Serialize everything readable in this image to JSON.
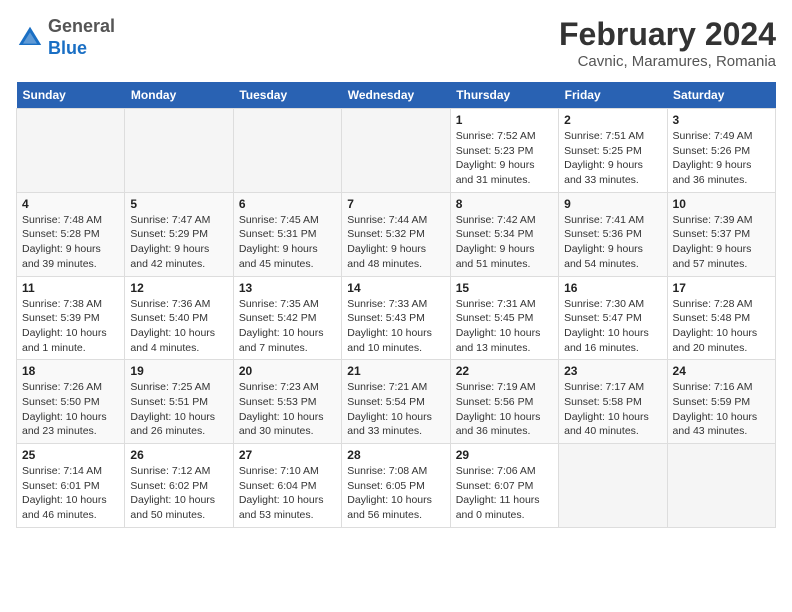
{
  "header": {
    "logo_line1": "General",
    "logo_line2": "Blue",
    "month": "February 2024",
    "location": "Cavnic, Maramures, Romania"
  },
  "days_of_week": [
    "Sunday",
    "Monday",
    "Tuesday",
    "Wednesday",
    "Thursday",
    "Friday",
    "Saturday"
  ],
  "weeks": [
    [
      {
        "num": "",
        "info": ""
      },
      {
        "num": "",
        "info": ""
      },
      {
        "num": "",
        "info": ""
      },
      {
        "num": "",
        "info": ""
      },
      {
        "num": "1",
        "info": "Sunrise: 7:52 AM\nSunset: 5:23 PM\nDaylight: 9 hours\nand 31 minutes."
      },
      {
        "num": "2",
        "info": "Sunrise: 7:51 AM\nSunset: 5:25 PM\nDaylight: 9 hours\nand 33 minutes."
      },
      {
        "num": "3",
        "info": "Sunrise: 7:49 AM\nSunset: 5:26 PM\nDaylight: 9 hours\nand 36 minutes."
      }
    ],
    [
      {
        "num": "4",
        "info": "Sunrise: 7:48 AM\nSunset: 5:28 PM\nDaylight: 9 hours\nand 39 minutes."
      },
      {
        "num": "5",
        "info": "Sunrise: 7:47 AM\nSunset: 5:29 PM\nDaylight: 9 hours\nand 42 minutes."
      },
      {
        "num": "6",
        "info": "Sunrise: 7:45 AM\nSunset: 5:31 PM\nDaylight: 9 hours\nand 45 minutes."
      },
      {
        "num": "7",
        "info": "Sunrise: 7:44 AM\nSunset: 5:32 PM\nDaylight: 9 hours\nand 48 minutes."
      },
      {
        "num": "8",
        "info": "Sunrise: 7:42 AM\nSunset: 5:34 PM\nDaylight: 9 hours\nand 51 minutes."
      },
      {
        "num": "9",
        "info": "Sunrise: 7:41 AM\nSunset: 5:36 PM\nDaylight: 9 hours\nand 54 minutes."
      },
      {
        "num": "10",
        "info": "Sunrise: 7:39 AM\nSunset: 5:37 PM\nDaylight: 9 hours\nand 57 minutes."
      }
    ],
    [
      {
        "num": "11",
        "info": "Sunrise: 7:38 AM\nSunset: 5:39 PM\nDaylight: 10 hours\nand 1 minute."
      },
      {
        "num": "12",
        "info": "Sunrise: 7:36 AM\nSunset: 5:40 PM\nDaylight: 10 hours\nand 4 minutes."
      },
      {
        "num": "13",
        "info": "Sunrise: 7:35 AM\nSunset: 5:42 PM\nDaylight: 10 hours\nand 7 minutes."
      },
      {
        "num": "14",
        "info": "Sunrise: 7:33 AM\nSunset: 5:43 PM\nDaylight: 10 hours\nand 10 minutes."
      },
      {
        "num": "15",
        "info": "Sunrise: 7:31 AM\nSunset: 5:45 PM\nDaylight: 10 hours\nand 13 minutes."
      },
      {
        "num": "16",
        "info": "Sunrise: 7:30 AM\nSunset: 5:47 PM\nDaylight: 10 hours\nand 16 minutes."
      },
      {
        "num": "17",
        "info": "Sunrise: 7:28 AM\nSunset: 5:48 PM\nDaylight: 10 hours\nand 20 minutes."
      }
    ],
    [
      {
        "num": "18",
        "info": "Sunrise: 7:26 AM\nSunset: 5:50 PM\nDaylight: 10 hours\nand 23 minutes."
      },
      {
        "num": "19",
        "info": "Sunrise: 7:25 AM\nSunset: 5:51 PM\nDaylight: 10 hours\nand 26 minutes."
      },
      {
        "num": "20",
        "info": "Sunrise: 7:23 AM\nSunset: 5:53 PM\nDaylight: 10 hours\nand 30 minutes."
      },
      {
        "num": "21",
        "info": "Sunrise: 7:21 AM\nSunset: 5:54 PM\nDaylight: 10 hours\nand 33 minutes."
      },
      {
        "num": "22",
        "info": "Sunrise: 7:19 AM\nSunset: 5:56 PM\nDaylight: 10 hours\nand 36 minutes."
      },
      {
        "num": "23",
        "info": "Sunrise: 7:17 AM\nSunset: 5:58 PM\nDaylight: 10 hours\nand 40 minutes."
      },
      {
        "num": "24",
        "info": "Sunrise: 7:16 AM\nSunset: 5:59 PM\nDaylight: 10 hours\nand 43 minutes."
      }
    ],
    [
      {
        "num": "25",
        "info": "Sunrise: 7:14 AM\nSunset: 6:01 PM\nDaylight: 10 hours\nand 46 minutes."
      },
      {
        "num": "26",
        "info": "Sunrise: 7:12 AM\nSunset: 6:02 PM\nDaylight: 10 hours\nand 50 minutes."
      },
      {
        "num": "27",
        "info": "Sunrise: 7:10 AM\nSunset: 6:04 PM\nDaylight: 10 hours\nand 53 minutes."
      },
      {
        "num": "28",
        "info": "Sunrise: 7:08 AM\nSunset: 6:05 PM\nDaylight: 10 hours\nand 56 minutes."
      },
      {
        "num": "29",
        "info": "Sunrise: 7:06 AM\nSunset: 6:07 PM\nDaylight: 11 hours\nand 0 minutes."
      },
      {
        "num": "",
        "info": ""
      },
      {
        "num": "",
        "info": ""
      }
    ]
  ]
}
